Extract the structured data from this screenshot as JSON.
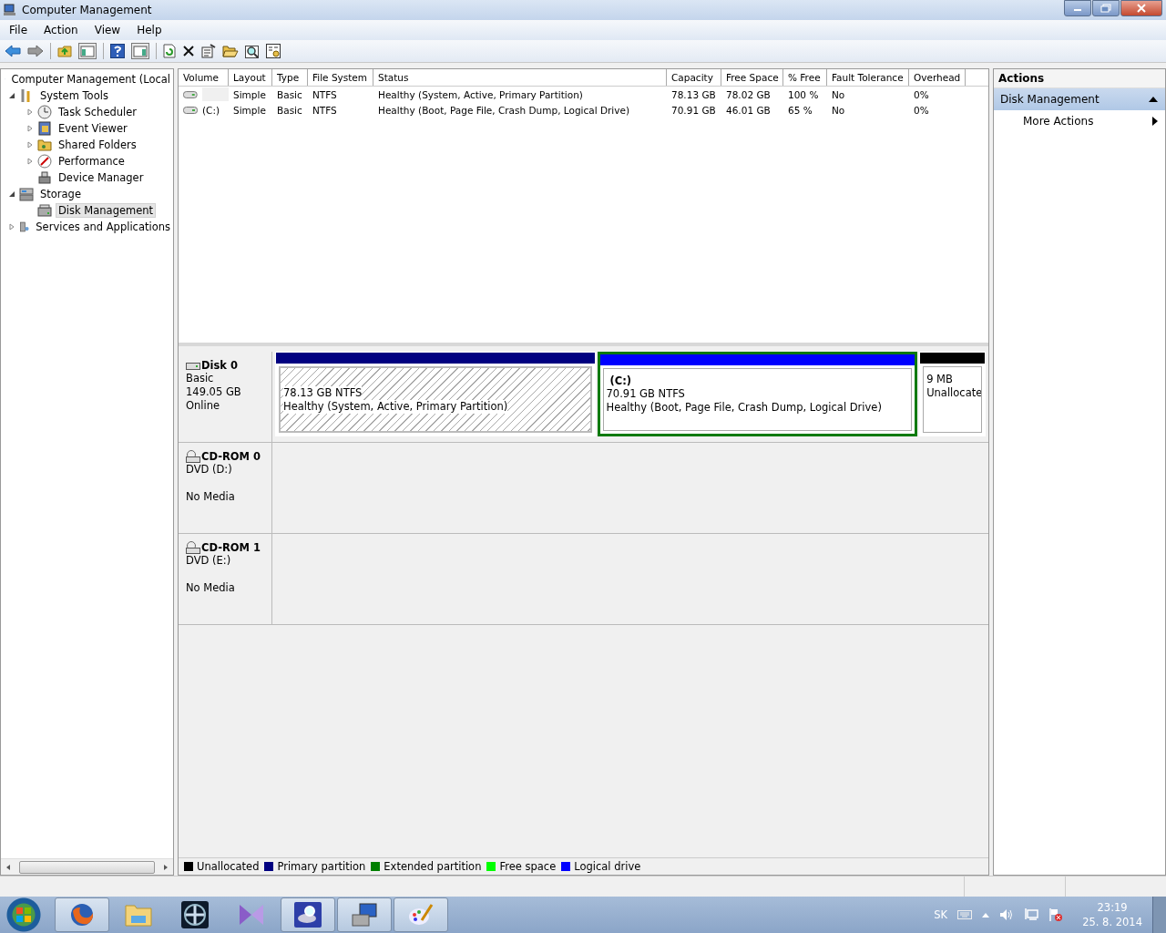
{
  "window": {
    "title": "Computer Management"
  },
  "menu": [
    "File",
    "Action",
    "View",
    "Help"
  ],
  "tree": [
    {
      "label": "Computer Management (Local",
      "selected": false,
      "children": [
        {
          "label": "System Tools",
          "expanded": true,
          "selected": false,
          "children": [
            {
              "label": "Task Scheduler",
              "expanded": false,
              "selected": false
            },
            {
              "label": "Event Viewer",
              "expanded": false,
              "selected": false
            },
            {
              "label": "Shared Folders",
              "expanded": false,
              "selected": false
            },
            {
              "label": "Performance",
              "expanded": false,
              "selected": false
            },
            {
              "label": "Device Manager",
              "selected": false
            }
          ]
        },
        {
          "label": "Storage",
          "expanded": true,
          "selected": false,
          "children": [
            {
              "label": "Disk Management",
              "selected": true
            }
          ]
        },
        {
          "label": "Services and Applications",
          "expanded": false,
          "selected": false
        }
      ]
    }
  ],
  "volumes": {
    "columns": [
      "Volume",
      "Layout",
      "Type",
      "File System",
      "Status",
      "Capacity",
      "Free Space",
      "% Free",
      "Fault Tolerance",
      "Overhead"
    ],
    "rows": [
      {
        "selected": false,
        "cells": [
          null,
          "Simple",
          "Basic",
          "NTFS",
          "Healthy (System, Active, Primary Partition)",
          "78.13 GB",
          "78.02 GB",
          "100 %",
          "No",
          "0%"
        ]
      },
      {
        "selected": false,
        "cells": [
          "(C:)",
          "Simple",
          "Basic",
          "NTFS",
          "Healthy (Boot, Page File, Crash Dump, Logical Drive)",
          "70.91 GB",
          "46.01 GB",
          "65 %",
          "No",
          "0%"
        ]
      }
    ]
  },
  "disks": [
    {
      "kind": "disk",
      "name": "Disk 0",
      "lines": [
        "Basic",
        "149.05 GB",
        "Online"
      ],
      "partitions": [
        {
          "kind": "primary",
          "size": "78.13 GB NTFS",
          "status": "Healthy (System, Active, Primary Partition)",
          "selected": false
        },
        {
          "kind": "logical",
          "label": "(C:)",
          "size": "70.91 GB NTFS",
          "status": "Healthy (Boot, Page File, Crash Dump, Logical Drive)",
          "selected": true
        },
        {
          "kind": "unallocated",
          "size": "9 MB",
          "status": "Unallocate",
          "selected": false
        }
      ]
    },
    {
      "kind": "cdrom",
      "name": "CD-ROM 0",
      "lines": [
        "DVD (D:)",
        "No Media"
      ]
    },
    {
      "kind": "cdrom",
      "name": "CD-ROM 1",
      "lines": [
        "DVD (E:)",
        "No Media"
      ]
    }
  ],
  "legend": [
    {
      "label": "Unallocated",
      "color": "#000000"
    },
    {
      "label": "Primary partition",
      "color": "#000080"
    },
    {
      "label": "Extended partition",
      "color": "#008000"
    },
    {
      "label": "Free space",
      "color": "#00ff00"
    },
    {
      "label": "Logical drive",
      "color": "#0000ff"
    }
  ],
  "actions": {
    "title": "Actions",
    "section": "Disk Management",
    "expanded": true,
    "items": [
      "More Actions"
    ]
  },
  "taskbar": {
    "apps": [
      {
        "kind": "firefox",
        "active": true
      },
      {
        "kind": "explorer",
        "active": false
      },
      {
        "kind": "fan",
        "active": false
      },
      {
        "kind": "media",
        "active": false
      },
      {
        "kind": "diskscan",
        "active": true
      },
      {
        "kind": "compmgmt",
        "active": true
      },
      {
        "kind": "paint",
        "active": true
      }
    ],
    "language": "SK",
    "time": "23:19",
    "date": "25. 8. 2014"
  }
}
